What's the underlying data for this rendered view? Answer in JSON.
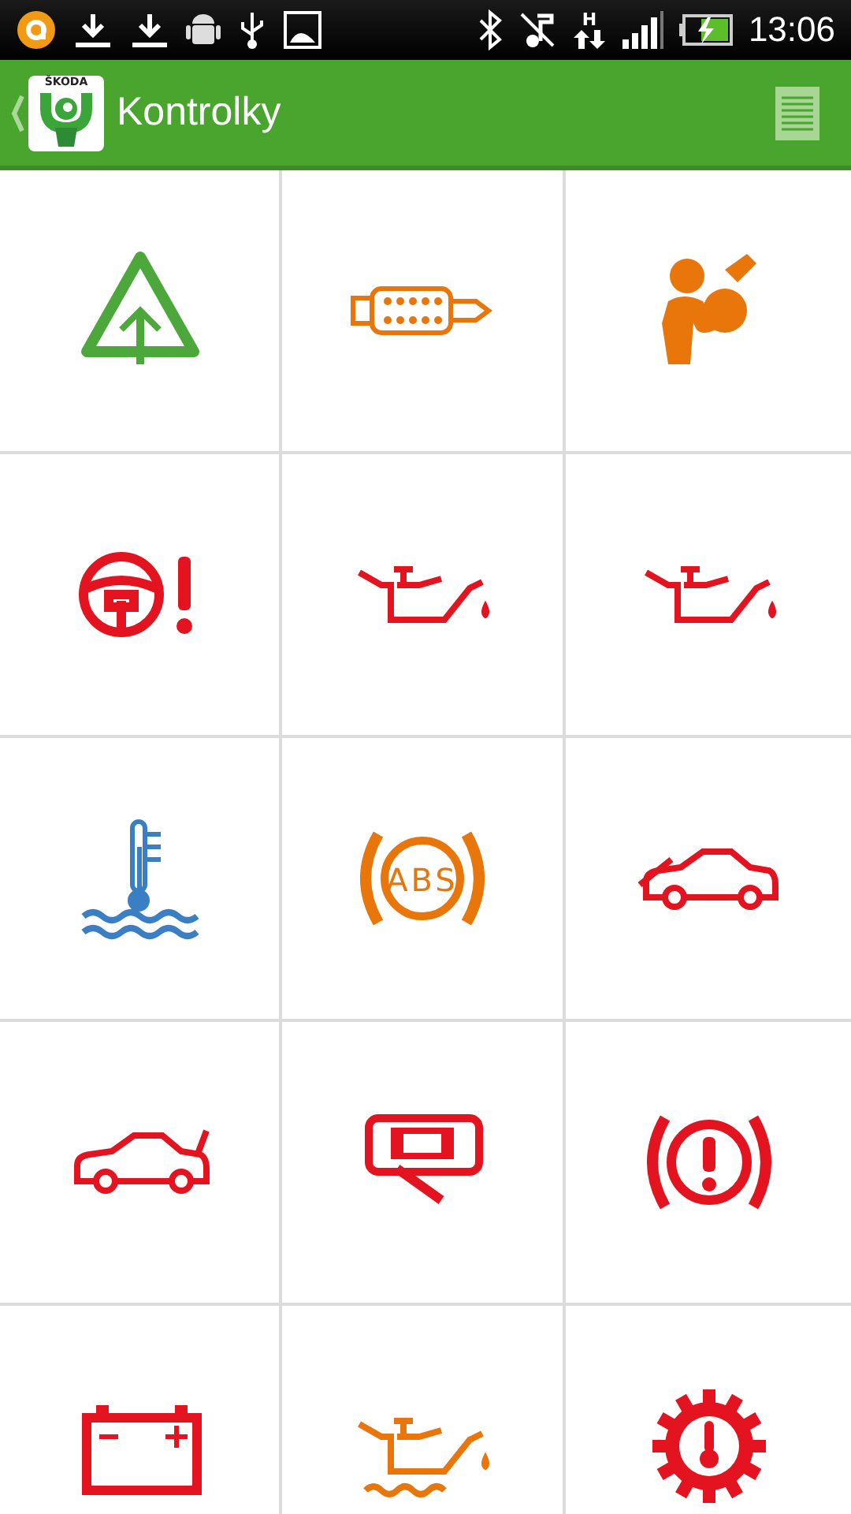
{
  "status_bar": {
    "network_type": "H",
    "time": "13:06"
  },
  "app_bar": {
    "logo_text": "ŠKODA",
    "title": "Kontrolky"
  },
  "warning_lights": [
    {
      "kind": "triangle",
      "color": "#4ca83a"
    },
    {
      "kind": "particle-filter",
      "color": "#e8760a"
    },
    {
      "kind": "airbag",
      "color": "#e8760a"
    },
    {
      "kind": "steering",
      "color": "#e3141f"
    },
    {
      "kind": "oil",
      "color": "#e3141f"
    },
    {
      "kind": "oil",
      "color": "#e3141f"
    },
    {
      "kind": "coolant",
      "color": "#3a7fc4"
    },
    {
      "kind": "abs",
      "color": "#e8760a",
      "label": "ABS"
    },
    {
      "kind": "hood",
      "color": "#e3141f"
    },
    {
      "kind": "trunk",
      "color": "#e3141f"
    },
    {
      "kind": "camera",
      "color": "#e3141f"
    },
    {
      "kind": "brake",
      "color": "#e3141f"
    },
    {
      "kind": "battery",
      "color": "#e3141f"
    },
    {
      "kind": "oil-level",
      "color": "#e8760a"
    },
    {
      "kind": "gear-temp",
      "color": "#e3141f"
    }
  ]
}
